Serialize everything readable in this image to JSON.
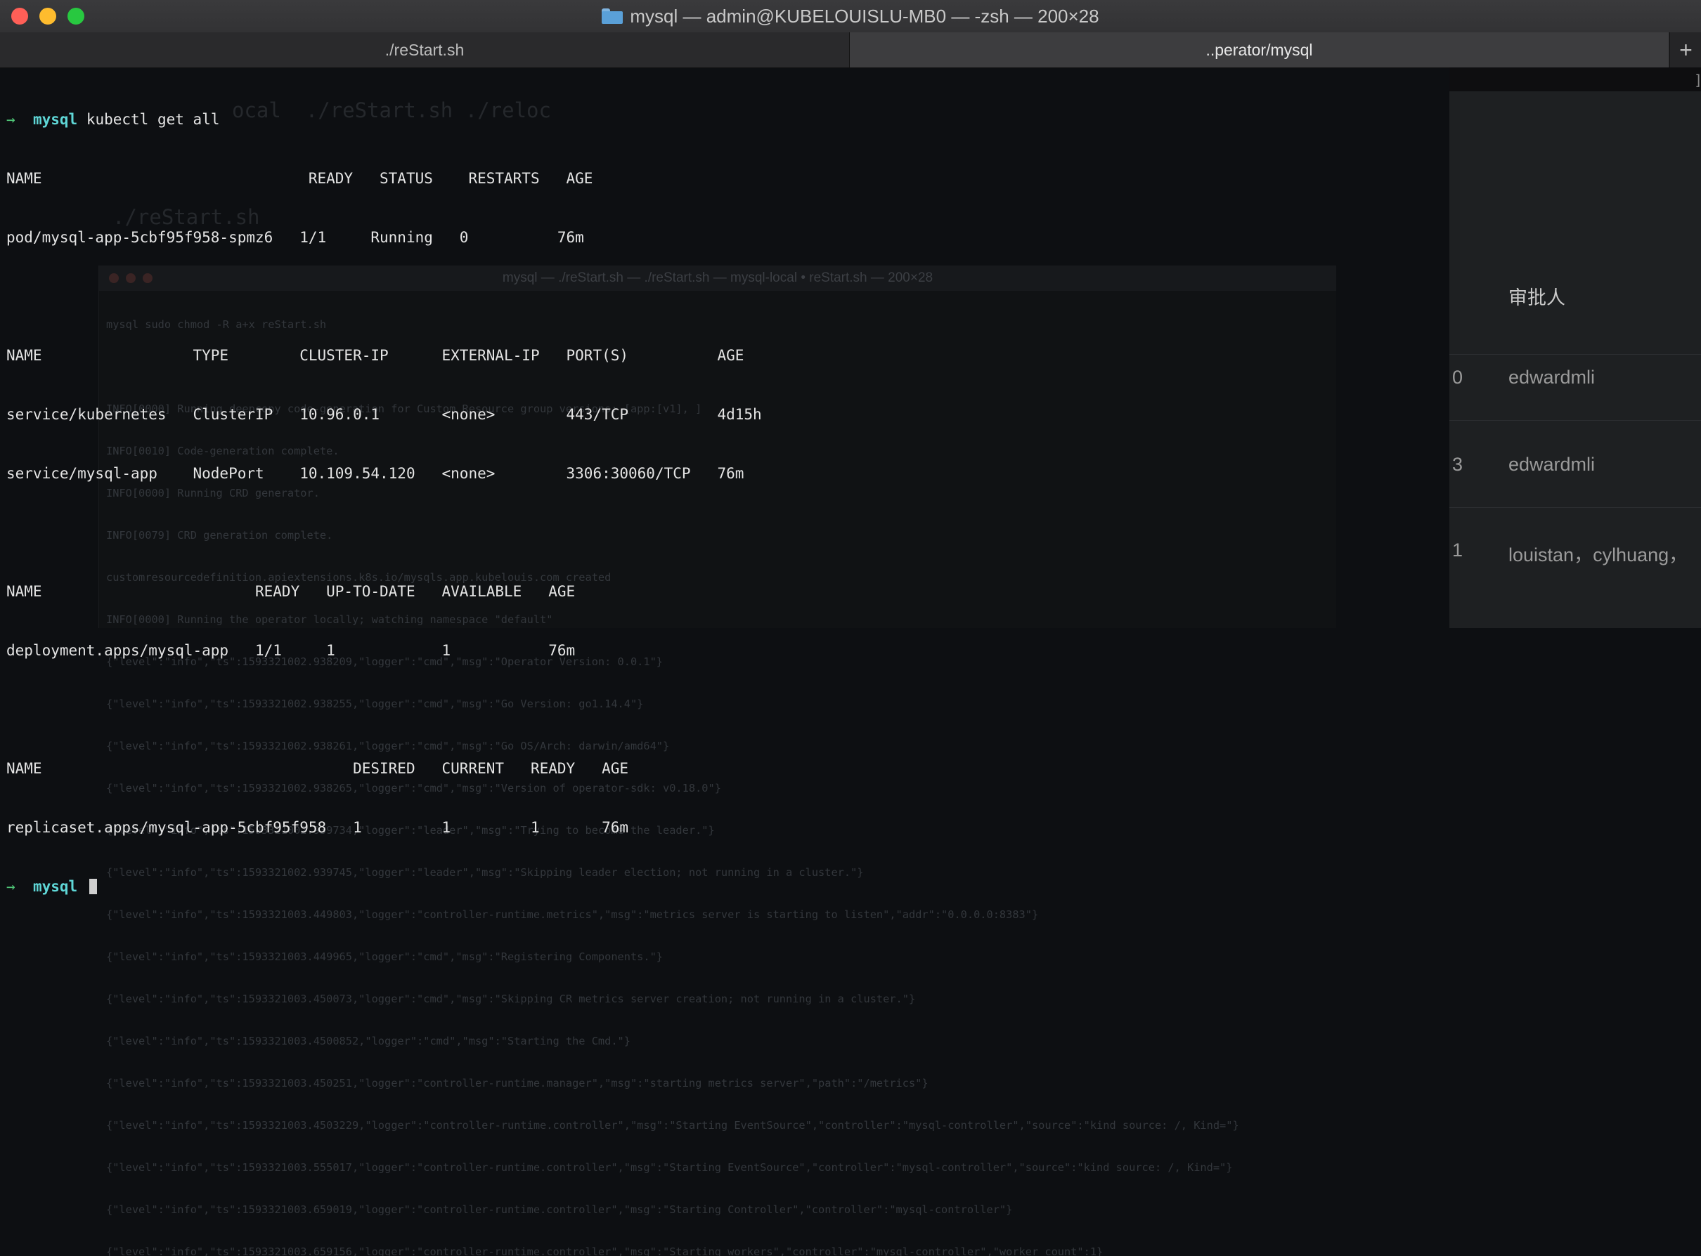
{
  "window": {
    "title": "mysql — admin@KUBELOUISLU-MB0 — -zsh — 200×28"
  },
  "tabs": [
    {
      "label": "./reStart.sh",
      "active": false
    },
    {
      "label": "..perator/mysql",
      "active": true
    }
  ],
  "new_tab_label": "+",
  "terminal": {
    "prompt_arrow": "→",
    "prompt_dir": "mysql",
    "command": "kubectl get all",
    "lines": [
      "NAME                              READY   STATUS    RESTARTS   AGE",
      "pod/mysql-app-5cbf95f958-spmz6   1/1     Running   0          76m",
      "",
      "NAME                 TYPE        CLUSTER-IP      EXTERNAL-IP   PORT(S)          AGE",
      "service/kubernetes   ClusterIP   10.96.0.1       <none>        443/TCP          4d15h",
      "service/mysql-app    NodePort    10.109.54.120   <none>        3306:30060/TCP   76m",
      "",
      "NAME                        READY   UP-TO-DATE   AVAILABLE   AGE",
      "deployment.apps/mysql-app   1/1     1            1           76m",
      "",
      "NAME                                   DESIRED   CURRENT   READY   AGE",
      "replicaset.apps/mysql-app-5cbf95f958   1         1         1       76m"
    ]
  },
  "background_window": {
    "title": "mysql — ./reStart.sh — ./reStart.sh — mysql-local • reStart.sh — 200×28",
    "prompt_line": "mysql sudo chmod -R a+x reStart.sh",
    "big_text_1": "ocal  ./reStart.sh ./reloc",
    "big_text_2": "./reStart.sh",
    "log_lines": [
      "INFO[0000] Running deepcopy code-generation for Custom Resource group versions: [app:[v1], ]",
      "INFO[0010] Code-generation complete.",
      "INFO[0000] Running CRD generator.",
      "INFO[0079] CRD generation complete.",
      "customresourcedefinition.apiextensions.k8s.io/mysqls.app.kubelouis.com created",
      "INFO[0000] Running the operator locally; watching namespace \"default\"",
      "{\"level\":\"info\",\"ts\":1593321002.938209,\"logger\":\"cmd\",\"msg\":\"Operator Version: 0.0.1\"}",
      "{\"level\":\"info\",\"ts\":1593321002.938255,\"logger\":\"cmd\",\"msg\":\"Go Version: go1.14.4\"}",
      "{\"level\":\"info\",\"ts\":1593321002.938261,\"logger\":\"cmd\",\"msg\":\"Go OS/Arch: darwin/amd64\"}",
      "{\"level\":\"info\",\"ts\":1593321002.938265,\"logger\":\"cmd\",\"msg\":\"Version of operator-sdk: v0.18.0\"}",
      "{\"level\":\"info\",\"ts\":1593321002.939734,\"logger\":\"leader\",\"msg\":\"Trying to become the leader.\"}",
      "{\"level\":\"info\",\"ts\":1593321002.939745,\"logger\":\"leader\",\"msg\":\"Skipping leader election; not running in a cluster.\"}",
      "{\"level\":\"info\",\"ts\":1593321003.449803,\"logger\":\"controller-runtime.metrics\",\"msg\":\"metrics server is starting to listen\",\"addr\":\"0.0.0.0:8383\"}",
      "{\"level\":\"info\",\"ts\":1593321003.449965,\"logger\":\"cmd\",\"msg\":\"Registering Components.\"}",
      "{\"level\":\"info\",\"ts\":1593321003.450073,\"logger\":\"cmd\",\"msg\":\"Skipping CR metrics server creation; not running in a cluster.\"}",
      "{\"level\":\"info\",\"ts\":1593321003.4500852,\"logger\":\"cmd\",\"msg\":\"Starting the Cmd.\"}",
      "{\"level\":\"info\",\"ts\":1593321003.450251,\"logger\":\"controller-runtime.manager\",\"msg\":\"starting metrics server\",\"path\":\"/metrics\"}",
      "{\"level\":\"info\",\"ts\":1593321003.4503229,\"logger\":\"controller-runtime.controller\",\"msg\":\"Starting EventSource\",\"controller\":\"mysql-controller\",\"source\":\"kind source: /, Kind=\"}",
      "{\"level\":\"info\",\"ts\":1593321003.555017,\"logger\":\"controller-runtime.controller\",\"msg\":\"Starting EventSource\",\"controller\":\"mysql-controller\",\"source\":\"kind source: /, Kind=\"}",
      "{\"level\":\"info\",\"ts\":1593321003.659019,\"logger\":\"controller-runtime.controller\",\"msg\":\"Starting Controller\",\"controller\":\"mysql-controller\"}",
      "{\"level\":\"info\",\"ts\":1593321003.659156,\"logger\":\"controller-runtime.controller\",\"msg\":\"Starting workers\",\"controller\":\"mysql-controller\",\"worker count\":1}"
    ]
  },
  "background_page": {
    "header": "审批人",
    "rows": [
      {
        "num": "0",
        "approver": "edwardmli"
      },
      {
        "num": "3",
        "approver": "edwardmli"
      },
      {
        "num": "1",
        "approver": "louistan，cylhuang，"
      }
    ]
  }
}
